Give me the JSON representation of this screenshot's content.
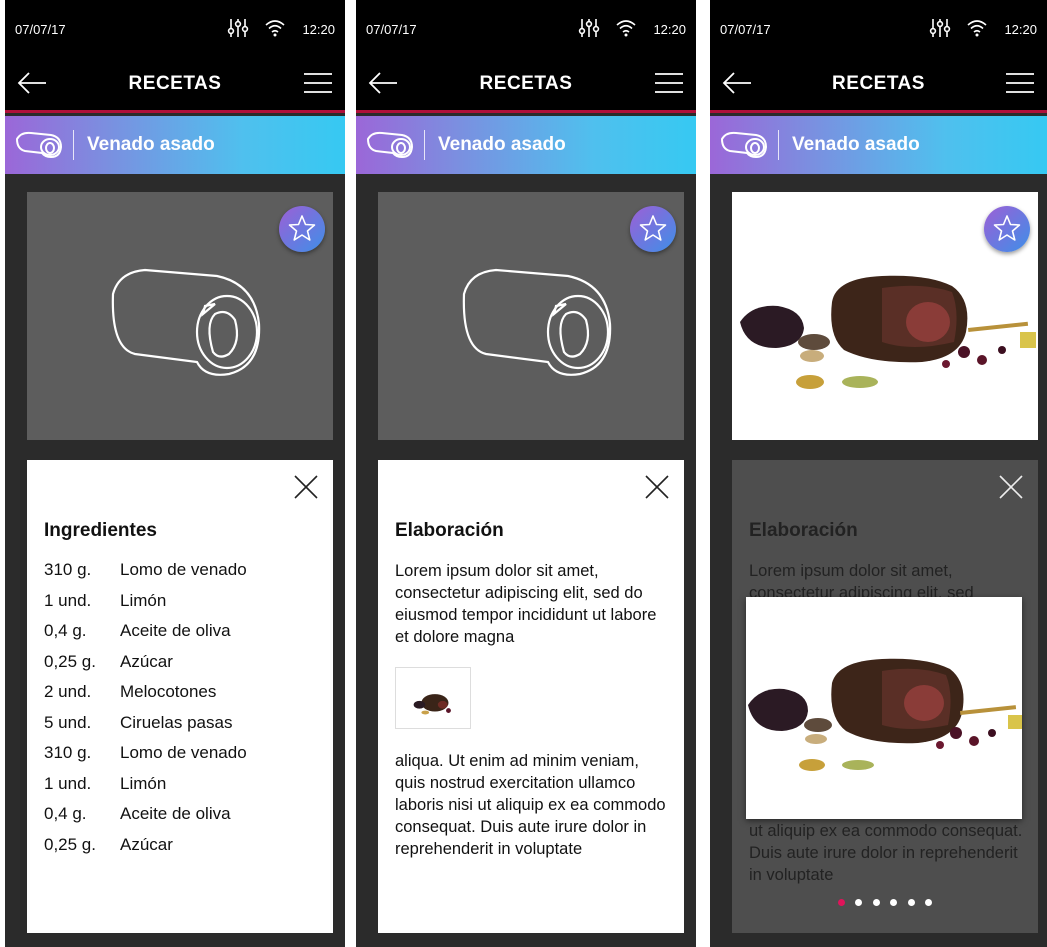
{
  "status": {
    "date": "07/07/17",
    "time": "12:20"
  },
  "appbar": {
    "title": "RECETAS"
  },
  "recipe": {
    "name": "Venado asado"
  },
  "ingredients": {
    "heading": "Ingredientes",
    "items": [
      {
        "qty": "310 g.",
        "name": "Lomo de venado"
      },
      {
        "qty": "1 und.",
        "name": "Limón"
      },
      {
        "qty": "0,4 g.",
        "name": "Aceite de oliva"
      },
      {
        "qty": "0,25 g.",
        "name": "Azúcar"
      },
      {
        "qty": "2 und.",
        "name": "Melocotones"
      },
      {
        "qty": "5 und.",
        "name": "Ciruelas pasas"
      },
      {
        "qty": "310 g.",
        "name": "Lomo de venado"
      },
      {
        "qty": "1 und.",
        "name": "Limón"
      },
      {
        "qty": "0,4 g.",
        "name": "Aceite de oliva"
      },
      {
        "qty": "0,25 g.",
        "name": "Azúcar"
      }
    ]
  },
  "elaboration": {
    "heading": "Elaboración",
    "para1": "Lorem ipsum dolor sit amet, consectetur adipiscing elit, sed do eiusmod tempor incididunt ut labore et dolore magna",
    "para2": "aliqua. Ut enim ad minim veniam, quis nostrud exercitation ullamco laboris nisi ut aliquip ex ea commodo consequat. Duis aute irure dolor in reprehenderit in voluptate",
    "para1_visible": "Lorem ipsum dolor sit amet, consectetur adipiscing elit, sed",
    "para2_visible": "ut aliquip ex ea commodo consequat. Duis aute irure dolor in reprehenderit in voluptate"
  },
  "gallery": {
    "dots": 6,
    "active_index": 0
  },
  "colors": {
    "accent": "#e0145a",
    "header_start": "#9b67d8",
    "header_end": "#36c9f2",
    "appbar_line": "#b0103a"
  },
  "icons": [
    "back-arrow-icon",
    "hamburger-menu-icon",
    "equalizer-icon",
    "wifi-icon",
    "meat-icon",
    "star-icon",
    "close-icon"
  ]
}
